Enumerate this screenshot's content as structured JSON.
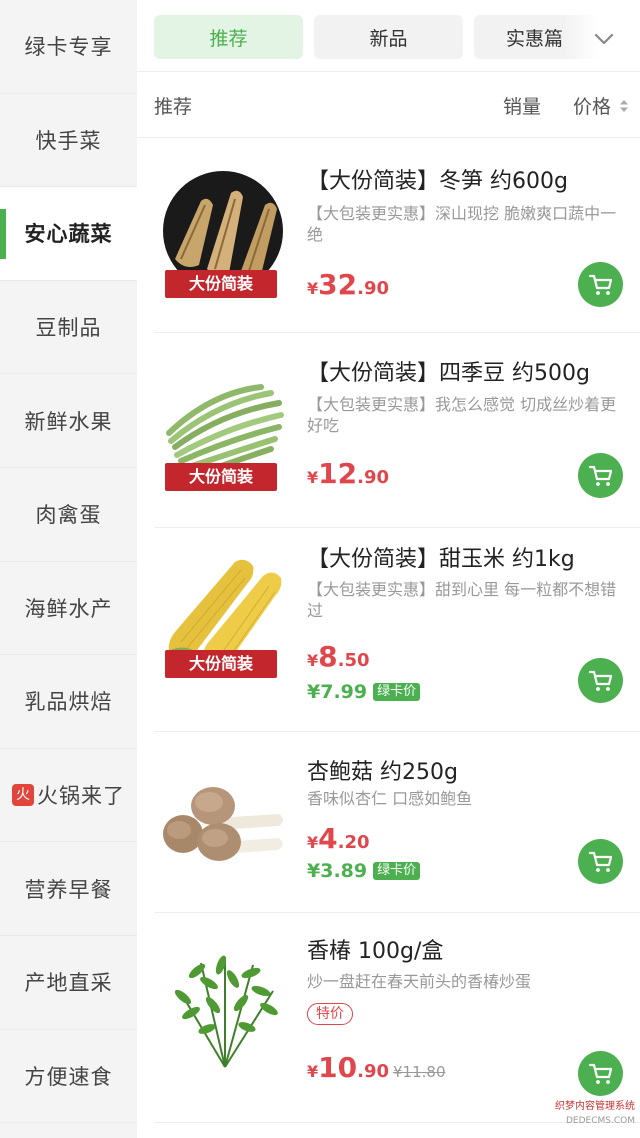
{
  "sidebar": {
    "items": [
      {
        "label": "绿卡专享"
      },
      {
        "label": "快手菜"
      },
      {
        "label": "安心蔬菜",
        "active": true
      },
      {
        "label": "豆制品"
      },
      {
        "label": "新鲜水果"
      },
      {
        "label": "肉禽蛋"
      },
      {
        "label": "海鲜水产"
      },
      {
        "label": "乳品烘焙"
      },
      {
        "label": "火锅来了",
        "badge": "火"
      },
      {
        "label": "营养早餐"
      },
      {
        "label": "产地直采"
      },
      {
        "label": "方便速食"
      }
    ]
  },
  "tabs": {
    "items": [
      {
        "label": "推荐",
        "active": true
      },
      {
        "label": "新品"
      },
      {
        "label": "实惠篇"
      }
    ],
    "more_icon": "chevron-down-icon"
  },
  "sortbar": {
    "label": "推荐",
    "sales": "销量",
    "price": "价格"
  },
  "products": [
    {
      "title": "【大份简装】冬笋 约600g",
      "desc": "【大包装更实惠】深山现挖 脆嫩爽口蔬中一绝",
      "tag": "大份简装",
      "price_currency": "¥",
      "price_int": "32",
      "price_dec": ".90",
      "image": "bamboo-shoot"
    },
    {
      "title": "【大份简装】四季豆 约500g",
      "desc": "【大包装更实惠】我怎么感觉 切成丝炒着更好吃",
      "tag": "大份简装",
      "price_currency": "¥",
      "price_int": "12",
      "price_dec": ".90",
      "image": "green-beans"
    },
    {
      "title": "【大份简装】甜玉米 约1kg",
      "desc": "【大包装更实惠】甜到心里 每一粒都不想错过",
      "tag": "大份简装",
      "price_currency": "¥",
      "price_int": "8",
      "price_dec": ".50",
      "member_price": "¥7.99",
      "member_label": "绿卡价",
      "image": "corn"
    },
    {
      "title": "杏鲍菇 约250g",
      "desc": "香味似杏仁 口感如鲍鱼",
      "price_currency": "¥",
      "price_int": "4",
      "price_dec": ".20",
      "member_price": "¥3.89",
      "member_label": "绿卡价",
      "image": "king-oyster-mushroom"
    },
    {
      "title": "香椿 100g/盒",
      "desc": "炒一盘赶在春天前头的香椿炒蛋",
      "badge": "特价",
      "price_currency": "¥",
      "price_int": "10",
      "price_dec": ".90",
      "old_price": "¥11.80",
      "image": "chinese-toon"
    }
  ],
  "watermark": {
    "line1": "织梦内容管理系统",
    "line2": "DEDECMS.COM"
  },
  "colors": {
    "accent_green": "#4cb050",
    "price_red": "#e0474c",
    "tag_red": "#c4262d"
  }
}
